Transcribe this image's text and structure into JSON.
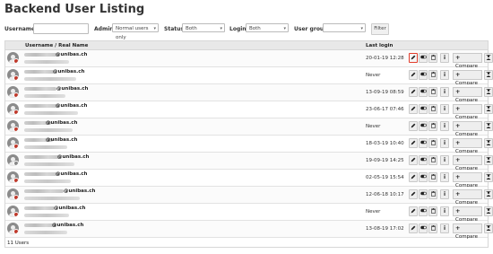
{
  "page": {
    "title": "Backend User Listing"
  },
  "filters": {
    "username_label": "Username",
    "username_value": "",
    "admin_label": "Admin",
    "admin_value": "Normal users only",
    "status_label": "Status",
    "status_value": "Both",
    "login_label": "Login",
    "login_value": "Both",
    "usergroup_label": "User group",
    "usergroup_value": "",
    "filter_button": "Filter"
  },
  "table": {
    "col_user": "Username / Real Name",
    "col_last_login": "Last login",
    "compare_label": "Compare",
    "rows": [
      {
        "email": "@unibas.ch",
        "last_login": "20-01-19 12:28",
        "status_color": "#c0392b"
      },
      {
        "email": "@unibas.ch",
        "last_login": "Never",
        "status_color": "#c0392b"
      },
      {
        "email": "@unibas.ch",
        "last_login": "13-09-19 08:59",
        "status_color": "#c0392b"
      },
      {
        "email": "@unibas.ch",
        "last_login": "23-06-17 07:46",
        "status_color": "#c0392b"
      },
      {
        "email": "@unibas.ch",
        "last_login": "Never",
        "status_color": "#c0392b"
      },
      {
        "email": "@unibas.ch",
        "last_login": "18-03-19 10:40",
        "status_color": "#c0392b"
      },
      {
        "email": "@unibas.ch",
        "last_login": "19-09-19 14:25",
        "status_color": "#888888"
      },
      {
        "email": "@unibas.ch",
        "last_login": "02-05-19 15:54",
        "status_color": "#c0392b"
      },
      {
        "email": "@unibas.ch",
        "last_login": "12-06-18 10:17",
        "status_color": "#c0392b"
      },
      {
        "email": "@unibas.ch",
        "last_login": "Never",
        "status_color": "#c0392b"
      },
      {
        "email": "@unibas.ch",
        "last_login": "13-08-19 17:02",
        "status_color": "#c0392b"
      }
    ],
    "footer": "11 Users"
  },
  "colors": {
    "highlight": "#e23e2d",
    "header_bg": "#e8e8e8",
    "button_bg": "#eeeeee"
  },
  "icons": [
    "user-avatar-icon",
    "pencil-icon",
    "toggle-icon",
    "trash-icon",
    "info-icon",
    "plus-icon",
    "switch-user-icon",
    "caret-down-icon"
  ]
}
